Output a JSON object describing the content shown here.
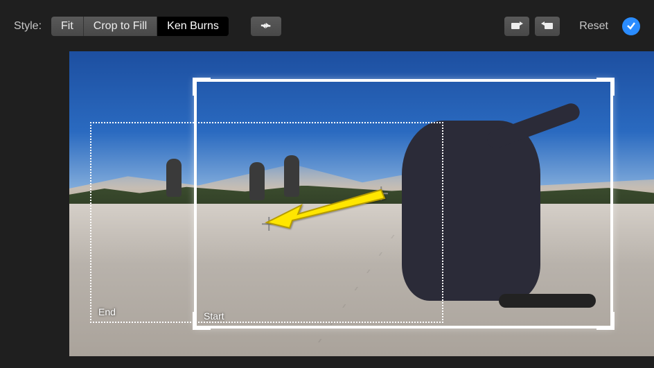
{
  "toolbar": {
    "style_label": "Style:",
    "styles": {
      "fit": "Fit",
      "crop": "Crop to Fill",
      "kenburns": "Ken Burns",
      "active": "kenburns"
    },
    "reset_label": "Reset"
  },
  "frames": {
    "start_label": "Start",
    "end_label": "End"
  }
}
